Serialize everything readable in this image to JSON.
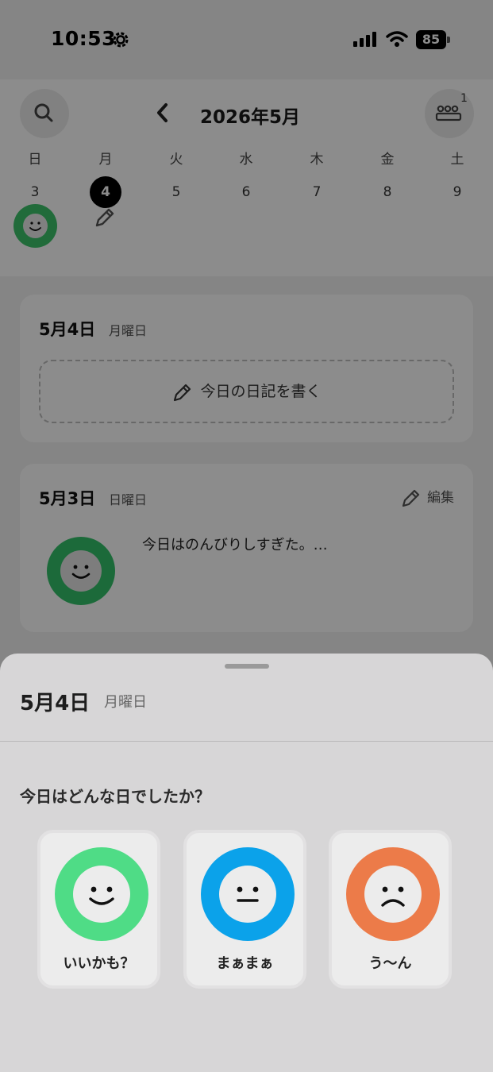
{
  "status": {
    "time": "10:53",
    "battery": "85"
  },
  "header": {
    "month_title": "2026年5月",
    "group_badge": "1"
  },
  "week": {
    "days": [
      {
        "dow": "日",
        "num": "3"
      },
      {
        "dow": "月",
        "num": "4"
      },
      {
        "dow": "火",
        "num": "5"
      },
      {
        "dow": "水",
        "num": "6"
      },
      {
        "dow": "木",
        "num": "7"
      },
      {
        "dow": "金",
        "num": "8"
      },
      {
        "dow": "土",
        "num": "9"
      }
    ]
  },
  "entries": [
    {
      "date": "5月4日",
      "dow": "月曜日",
      "write_label": "今日の日記を書く"
    },
    {
      "date": "5月3日",
      "dow": "日曜日",
      "edit_label": "編集",
      "excerpt": "今日はのんびりしすぎた。…",
      "mood_color": "#34c26a"
    }
  ],
  "sheet": {
    "date": "5月4日",
    "dow": "月曜日",
    "question": "今日はどんな日でしたか？",
    "moods": [
      {
        "label": "いいかも？",
        "color": "#4fdc86",
        "icon": "smile-face-icon"
      },
      {
        "label": "まぁまぁ",
        "color": "#0ba2ea",
        "icon": "neutral-face-icon"
      },
      {
        "label": "う〜ん",
        "color": "#ec7b49",
        "icon": "frown-face-icon"
      }
    ]
  }
}
